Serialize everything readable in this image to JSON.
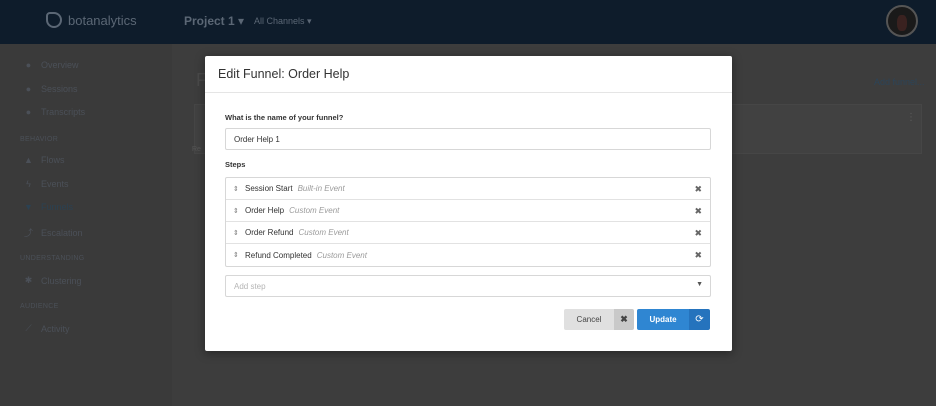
{
  "app": {
    "brand": "botanalytics",
    "project": "Project 1 ▾",
    "channels": "All Channels ▾"
  },
  "sidebar": {
    "items": [
      {
        "label": "Overview",
        "icon": "●"
      },
      {
        "label": "Sessions",
        "icon": "●"
      },
      {
        "label": "Transcripts",
        "icon": "●"
      },
      {
        "label": "Flows",
        "icon": "▲"
      },
      {
        "label": "Events",
        "icon": "ϟ"
      },
      {
        "label": "Funnels",
        "icon": "▼"
      },
      {
        "label": "Escalation",
        "icon": "⤴"
      },
      {
        "label": "Clustering",
        "icon": "✱"
      },
      {
        "label": "Activity",
        "icon": "⟋"
      }
    ],
    "sections": [
      "BEHAVIOR",
      "UNDERSTANDING",
      "AUDIENCE"
    ]
  },
  "background": {
    "title": "F",
    "add_link": "Add funnel...",
    "card_tag": "Re"
  },
  "modal": {
    "title": "Edit Funnel: Order Help",
    "name_label": "What is the name of your funnel?",
    "name_value": "Order Help 1",
    "steps_label": "Steps",
    "steps": [
      {
        "name": "Session Start",
        "type": "Built-in Event"
      },
      {
        "name": "Order Help",
        "type": "Custom Event"
      },
      {
        "name": "Order Refund",
        "type": "Custom Event"
      },
      {
        "name": "Refund Completed",
        "type": "Custom Event"
      }
    ],
    "add_step_placeholder": "Add step",
    "cancel_label": "Cancel",
    "update_label": "Update"
  },
  "colors": {
    "primary": "#2f86d2",
    "topbar": "#0e1c2b"
  }
}
